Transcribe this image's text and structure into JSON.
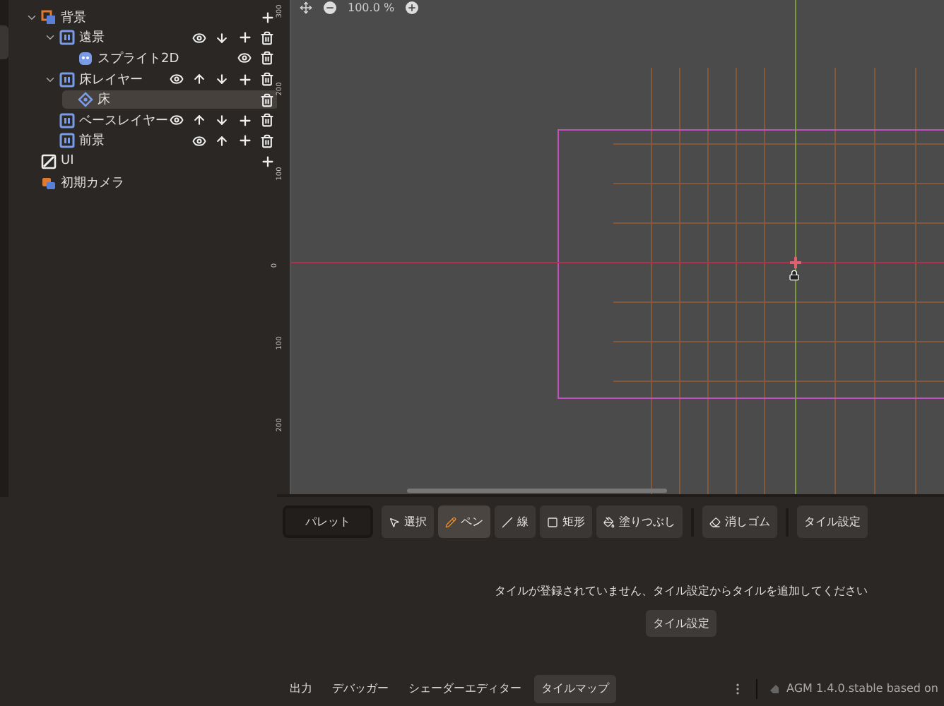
{
  "scene_tree": [
    {
      "label": "背景",
      "kind": "group",
      "expanded": true,
      "actions": [
        {
          "kind": "add"
        }
      ],
      "children": [
        {
          "label": "遠景",
          "kind": "layer",
          "expanded": true,
          "actions": [
            {
              "kind": "visibility"
            },
            {
              "kind": "move_down"
            },
            {
              "kind": "add"
            },
            {
              "kind": "delete"
            }
          ],
          "children": [
            {
              "label": "スプライト2D",
              "kind": "sprite",
              "selected": false,
              "actions": [
                {
                  "kind": "visibility"
                },
                {
                  "kind": "delete"
                }
              ]
            }
          ],
          "selected": false
        },
        {
          "label": "床レイヤー",
          "kind": "layer",
          "expanded": true,
          "actions": [
            {
              "kind": "visibility"
            },
            {
              "kind": "move_up"
            },
            {
              "kind": "move_down"
            },
            {
              "kind": "add"
            },
            {
              "kind": "delete"
            }
          ],
          "children": [
            {
              "label": "床",
              "kind": "tilemap",
              "selected": true,
              "actions": [
                {
                  "kind": "delete"
                }
              ]
            }
          ],
          "selected": false
        },
        {
          "label": "ベースレイヤー",
          "kind": "layer",
          "selected": false,
          "actions": [
            {
              "kind": "visibility"
            },
            {
              "kind": "move_up"
            },
            {
              "kind": "move_down"
            },
            {
              "kind": "add"
            },
            {
              "kind": "delete"
            }
          ]
        },
        {
          "label": "前景",
          "kind": "layer",
          "selected": false,
          "actions": [
            {
              "kind": "visibility"
            },
            {
              "kind": "move_up"
            },
            {
              "kind": "add"
            },
            {
              "kind": "delete"
            }
          ]
        }
      ],
      "selected": false
    },
    {
      "label": "UI",
      "kind": "ui",
      "selected": false,
      "actions": [
        {
          "kind": "add"
        }
      ]
    },
    {
      "label": "初期カメラ",
      "kind": "camera",
      "selected": false
    }
  ],
  "viewport": {
    "zoom": "100.0 %",
    "ruler_labels": [
      "300",
      "200",
      "100",
      "0",
      "100",
      "200"
    ]
  },
  "tilemap_panel": {
    "palette_button": "パレット",
    "tools": [
      {
        "label": "選択",
        "kind": "select",
        "selected": false
      },
      {
        "label": "ペン",
        "kind": "pen",
        "selected": true
      },
      {
        "label": "線",
        "kind": "line",
        "selected": false
      },
      {
        "label": "矩形",
        "kind": "rect",
        "selected": false
      },
      {
        "label": "塗りつぶし",
        "kind": "fill",
        "selected": false
      },
      {
        "label": "消しゴム",
        "kind": "eraser",
        "selected": false,
        "separator_before": true
      },
      {
        "label": "タイル設定",
        "kind": "settings",
        "selected": false,
        "separator_before": true
      }
    ],
    "message": "タイルが登録されていません、タイル設定からタイルを追加してください",
    "action_button": "タイル設定"
  },
  "bottom_tabs": [
    {
      "label": "出力",
      "selected": false
    },
    {
      "label": "デバッガー",
      "selected": false
    },
    {
      "label": "シェーダーエディター",
      "selected": false
    },
    {
      "label": "タイルマップ",
      "selected": true
    }
  ],
  "status": {
    "version": "AGM 1.4.0.stable based on"
  }
}
